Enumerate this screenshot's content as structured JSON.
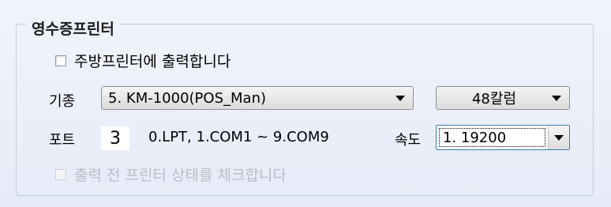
{
  "group": {
    "title": "영수증프린터"
  },
  "kitchen_print": {
    "label": "주방프린터에 출력합니다",
    "checked": false
  },
  "model": {
    "label": "기종",
    "selected": "5. KM-1000(POS_Man)"
  },
  "columns": {
    "selected": "48칼럼"
  },
  "port": {
    "label": "포트",
    "value": "3",
    "hint": "0.LPT, 1.COM1 ~ 9.COM9"
  },
  "speed": {
    "label": "속도",
    "selected": "1. 19200"
  },
  "status_check": {
    "label": "출력 전 프린터 상태를 체크합니다",
    "checked": false,
    "enabled": false
  }
}
